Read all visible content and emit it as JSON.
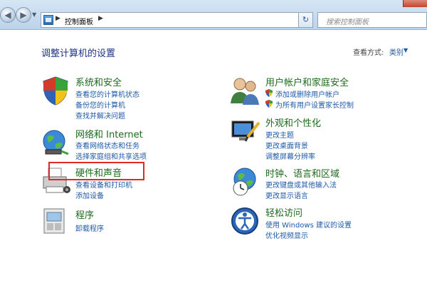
{
  "address": {
    "path": "控制面板"
  },
  "search": {
    "placeholder": "搜索控制面板"
  },
  "main": {
    "title": "调整计算机的设置",
    "view_by_label": "查看方式:",
    "view_by_value": "类别"
  },
  "categories": {
    "system": {
      "title": "系统和安全",
      "links": [
        "查看您的计算机状态",
        "备份您的计算机",
        "查找并解决问题"
      ]
    },
    "network": {
      "title": "网络和 Internet",
      "links": [
        "查看网络状态和任务",
        "选择家庭组和共享选项"
      ]
    },
    "hardware": {
      "title": "硬件和声音",
      "links": [
        "查看设备和打印机",
        "添加设备"
      ]
    },
    "programs": {
      "title": "程序",
      "links": [
        "卸载程序"
      ]
    },
    "accounts": {
      "title": "用户帐户和家庭安全",
      "links": [
        "添加或删除用户帐户",
        "为所有用户设置家长控制"
      ]
    },
    "appearance": {
      "title": "外观和个性化",
      "links": [
        "更改主题",
        "更改桌面背景",
        "调整屏幕分辨率"
      ]
    },
    "clock": {
      "title": "时钟、语言和区域",
      "links": [
        "更改键盘或其他输入法",
        "更改显示语言"
      ]
    },
    "ease": {
      "title": "轻松访问",
      "links": [
        "使用 Windows 建议的设置",
        "优化视频显示"
      ]
    }
  },
  "icons": {
    "back": "back-arrow-icon",
    "forward": "forward-arrow-icon",
    "refresh": "refresh-icon",
    "search": "search-icon",
    "system": "shield-icon",
    "network": "globe-network-icon",
    "hardware": "printer-icon",
    "programs": "programs-icon",
    "accounts": "users-icon",
    "appearance": "display-paint-icon",
    "clock": "clock-globe-icon",
    "ease": "accessibility-icon"
  },
  "colors": {
    "title": "#1e3287",
    "category": "#1c6b1c",
    "link": "#1e5aa8",
    "highlight": "#e02a2a"
  }
}
